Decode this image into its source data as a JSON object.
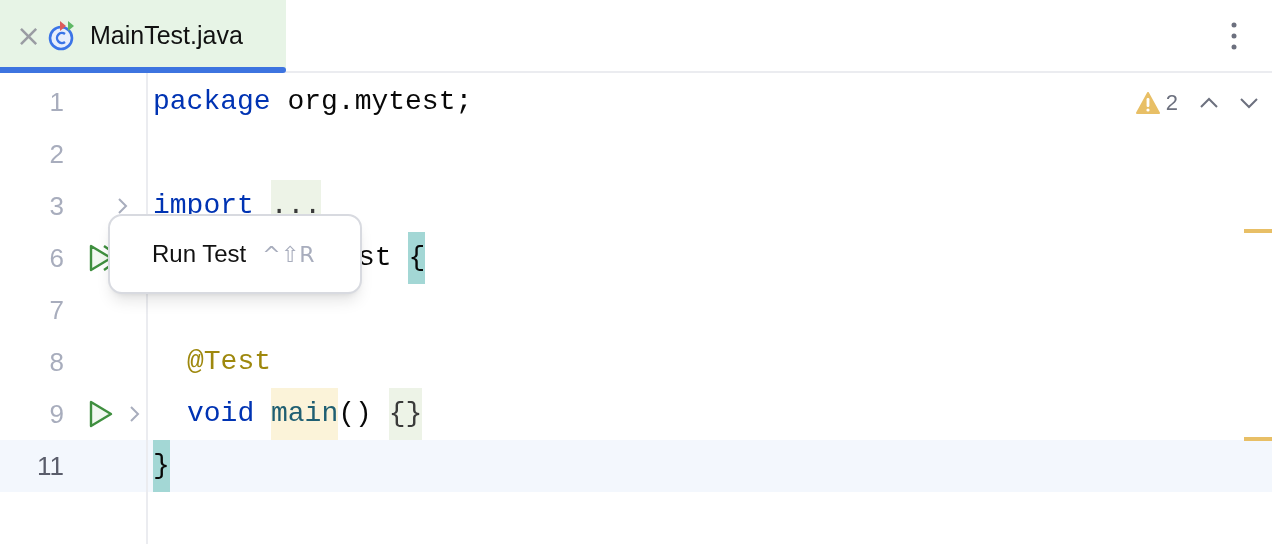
{
  "tab": {
    "close": "×",
    "title": "MainTest.java",
    "selected": true
  },
  "inspections": {
    "warning_count": "2"
  },
  "lines": [
    {
      "number": "1",
      "kind": "plain",
      "tokens": [
        {
          "text": "package ",
          "kind": "keyword"
        },
        {
          "text": "org.mytest;",
          "kind": "plain"
        }
      ]
    },
    {
      "number": "2",
      "kind": "plain"
    },
    {
      "number": "3",
      "kind": "fold",
      "tokens": [
        {
          "text": "import ",
          "kind": "keyword"
        },
        {
          "text": "...",
          "kind": "folded"
        }
      ]
    },
    {
      "number": "6",
      "kind": "run_class",
      "covered": true,
      "tokens": [
        {
          "text": "st ",
          "kind": "plain"
        },
        {
          "text": "{",
          "kind": "brace_match"
        }
      ]
    },
    {
      "number": "7",
      "kind": "plain"
    },
    {
      "number": "8",
      "kind": "plain",
      "indented": true,
      "tokens": [
        {
          "text": "@Test",
          "kind": "annotation"
        }
      ]
    },
    {
      "number": "9",
      "kind": "run_fold",
      "indented": true,
      "tokens": [
        {
          "text": "void ",
          "kind": "keyword"
        },
        {
          "text": "main",
          "kind": "method_unused"
        },
        {
          "text": "() ",
          "kind": "plain"
        },
        {
          "text": "{}",
          "kind": "folded"
        }
      ]
    },
    {
      "number": "11",
      "kind": "plain",
      "current": true,
      "tokens": [
        {
          "text": "}",
          "kind": "brace_match"
        }
      ]
    }
  ],
  "tooltip": {
    "label": "Run Test",
    "shortcut": "^⇧R"
  }
}
